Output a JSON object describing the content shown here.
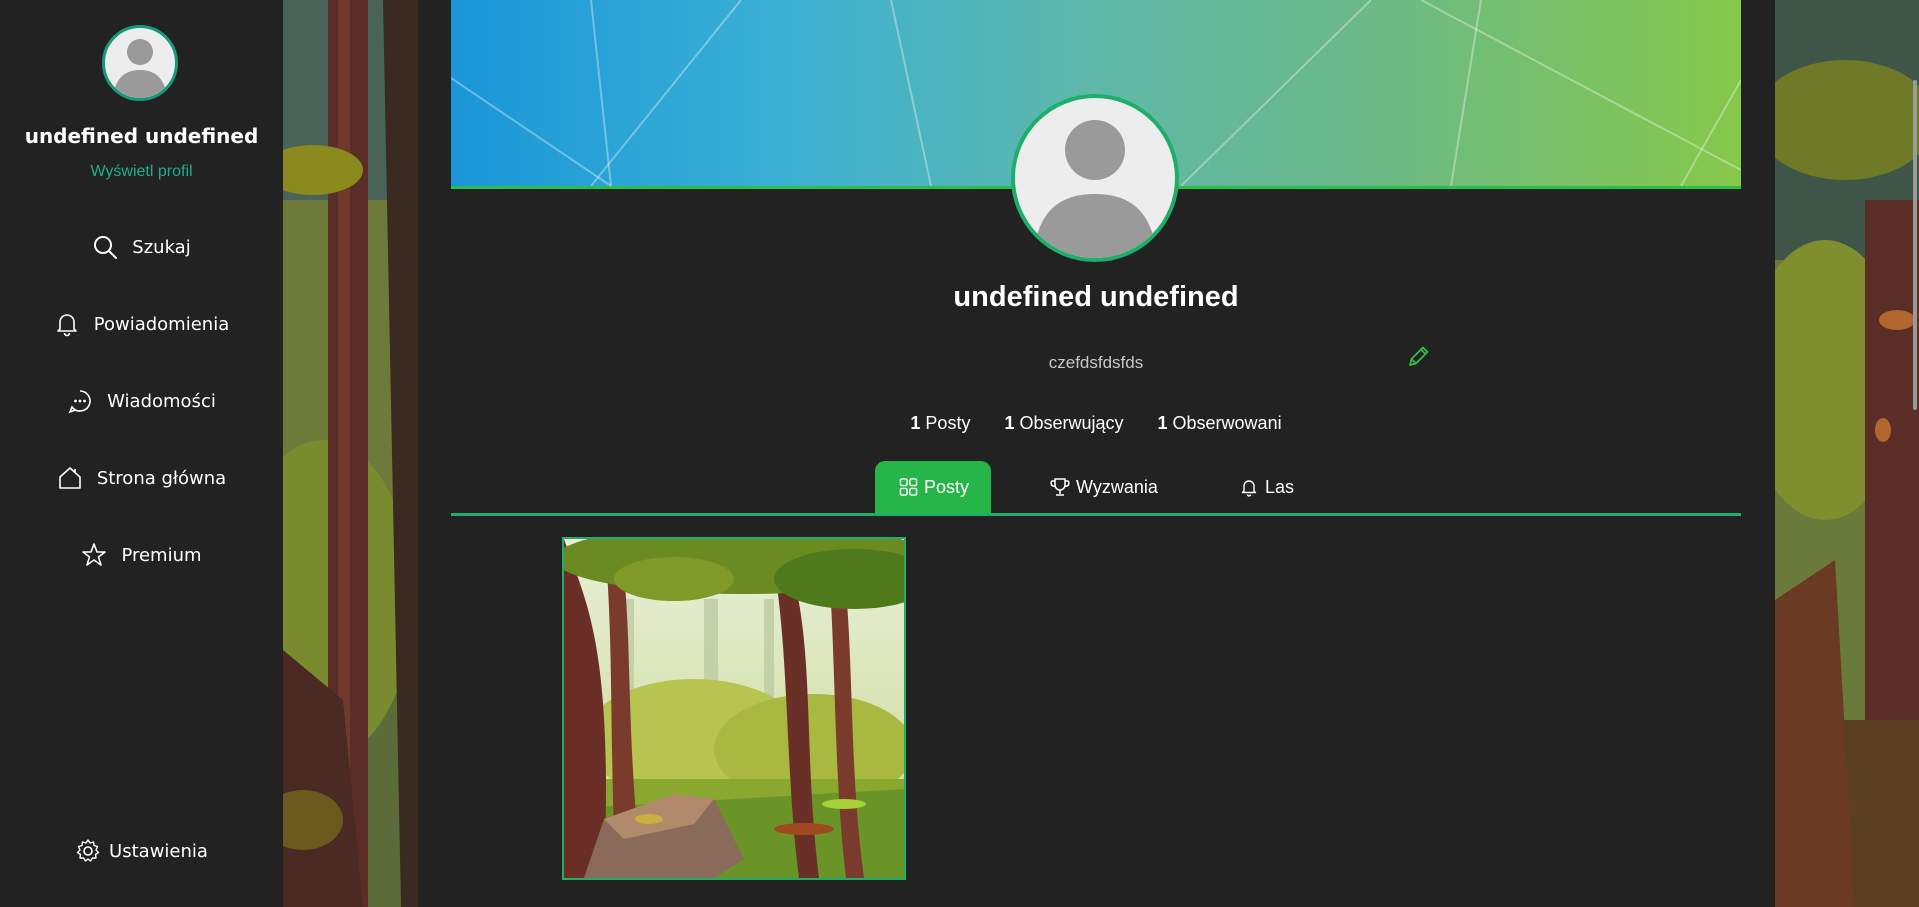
{
  "sidebar": {
    "user_name": "undefined undefined",
    "view_profile": "Wyświetl profil",
    "items": [
      {
        "label": "Szukaj",
        "icon": "search-icon"
      },
      {
        "label": "Powiadomienia",
        "icon": "bell-icon"
      },
      {
        "label": "Wiadomości",
        "icon": "chat-icon"
      },
      {
        "label": "Strona główna",
        "icon": "home-icon"
      },
      {
        "label": "Premium",
        "icon": "star-icon"
      }
    ],
    "settings": {
      "label": "Ustawienia",
      "icon": "gear-icon"
    }
  },
  "profile": {
    "name": "undefined undefined",
    "bio": "czefdsfdsfds",
    "stats": [
      {
        "count": "1",
        "label": "Posty"
      },
      {
        "count": "1",
        "label": "Obserwujący"
      },
      {
        "count": "1",
        "label": "Obserwowani"
      }
    ]
  },
  "tabs": [
    {
      "label": "Posty",
      "icon": "grid-icon",
      "active": true
    },
    {
      "label": "Wyzwania",
      "icon": "trophy-icon",
      "active": false
    },
    {
      "label": "Las",
      "icon": "bell-icon",
      "active": false
    }
  ],
  "colors": {
    "accent": "#26b548",
    "teal": "#1fae8a",
    "background": "#222222"
  }
}
